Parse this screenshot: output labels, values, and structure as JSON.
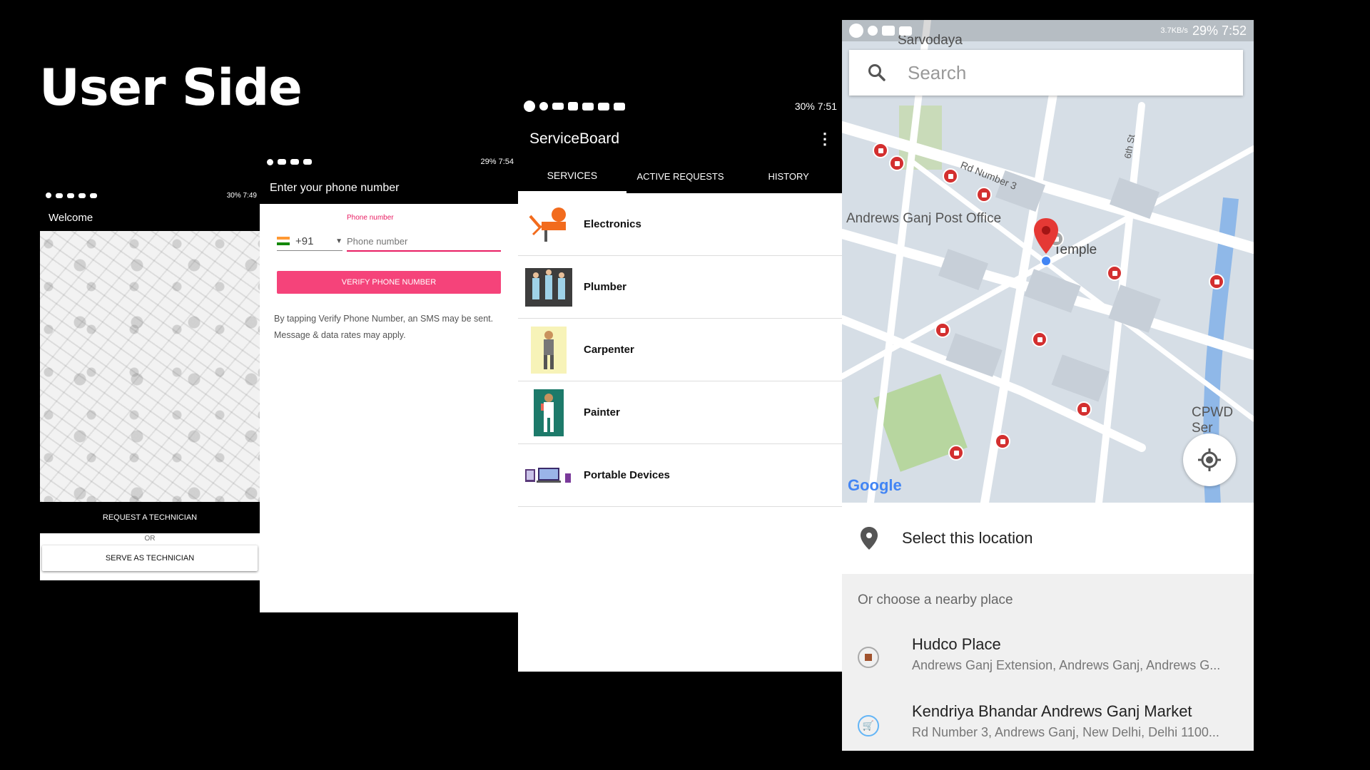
{
  "page": {
    "title": "User Side"
  },
  "screen1": {
    "status_time": "30% 7:49",
    "app_title": "Welcome",
    "request_button": "REQUEST A TECHNICIAN",
    "or_text": "OR",
    "serve_button": "SERVE AS TECHNICIAN"
  },
  "screen2": {
    "status_time": "29% 7:54",
    "app_title": "Enter your phone number",
    "phone_label": "Phone number",
    "country_code": "+91",
    "phone_placeholder": "Phone number",
    "verify_button": "VERIFY PHONE NUMBER",
    "disclaimer": "By tapping Verify Phone Number, an SMS may be sent. Message & data rates may apply."
  },
  "screen3": {
    "status_time": "30% 7:51",
    "app_title": "ServiceBoard",
    "tabs": [
      "SERVICES",
      "ACTIVE REQUESTS",
      "HISTORY"
    ],
    "services": [
      "Electronics",
      "Plumber",
      "Carpenter",
      "Painter",
      "Portable Devices"
    ]
  },
  "screen4": {
    "status_speed": "3.7KB/s",
    "status_time": "29% 7:52",
    "search_placeholder": "Search",
    "map_labels": [
      "Sarvodaya",
      "Andrews Ganj Post Office",
      "Temple",
      "Rd Number 3",
      "6th St",
      "CPWD Ser",
      "Google"
    ],
    "select_location": "Select this location",
    "nearby_header": "Or choose a nearby place",
    "places": [
      {
        "name": "Hudco Place",
        "address": "Andrews Ganj Extension, Andrews Ganj, Andrews G..."
      },
      {
        "name": "Kendriya Bhandar Andrews Ganj Market",
        "address": "Rd Number 3, Andrews Ganj, New Delhi, Delhi 1100..."
      }
    ]
  }
}
